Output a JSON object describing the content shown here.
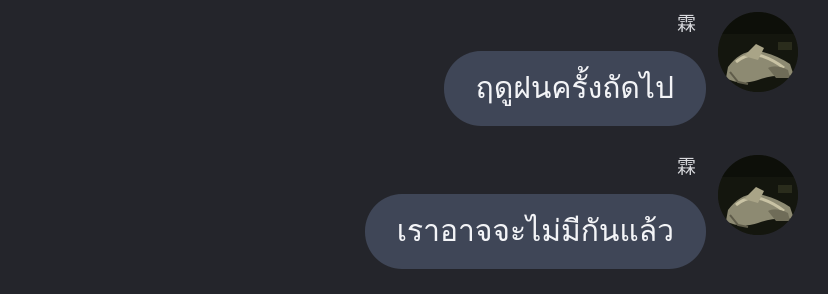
{
  "messages": [
    {
      "sender": "霖",
      "text": "ฤดูฝนครั้งถัดไป"
    },
    {
      "sender": "霖",
      "text": "เราอาจจะไม่มีกันแล้ว"
    }
  ],
  "colors": {
    "background": "#24252b",
    "bubble": "#3f4657",
    "bubble_text": "#f3f4f7",
    "name_text": "#d8d9dd"
  }
}
